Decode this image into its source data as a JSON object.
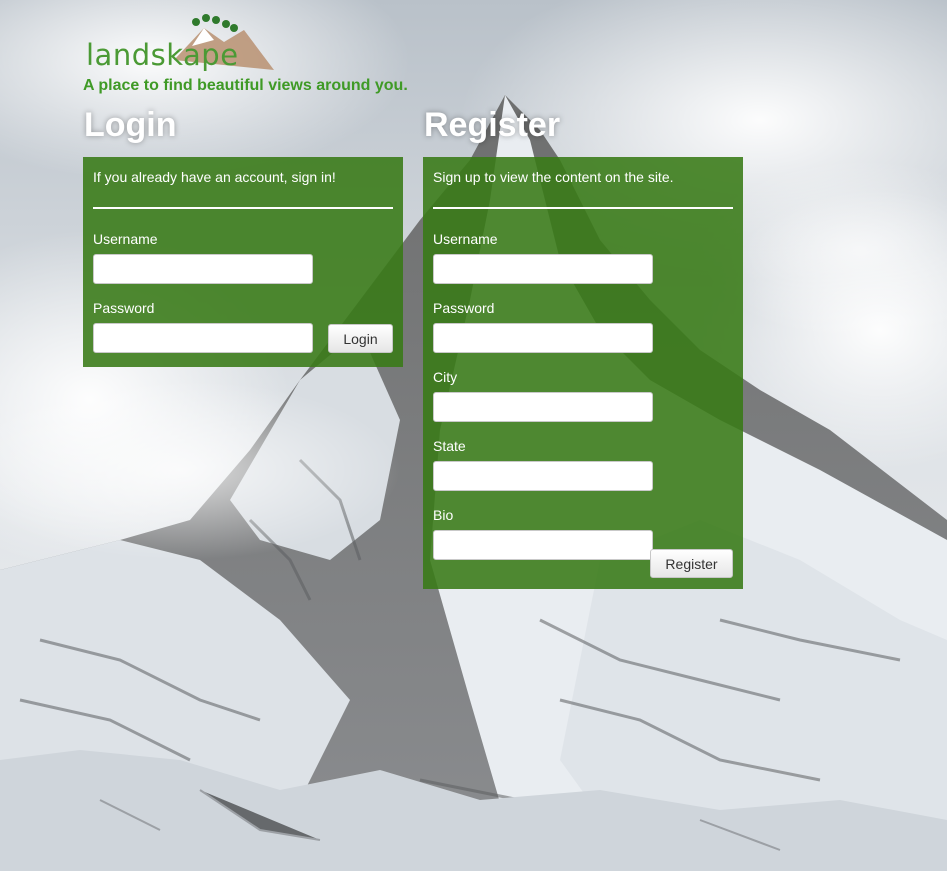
{
  "branding": {
    "logo_text": "landskape",
    "tagline": "A place to find beautiful views around you.",
    "brand_color": "#3f9a26"
  },
  "login": {
    "title": "Login",
    "intro": "If you already have an account, sign in!",
    "username_label": "Username",
    "username_value": "",
    "password_label": "Password",
    "password_value": "",
    "submit_label": "Login"
  },
  "register": {
    "title": "Register",
    "intro": "Sign up to view the content on the site.",
    "username_label": "Username",
    "username_value": "",
    "password_label": "Password",
    "password_value": "",
    "city_label": "City",
    "city_value": "",
    "state_label": "State",
    "state_value": "",
    "bio_label": "Bio",
    "bio_value": "",
    "submit_label": "Register"
  },
  "colors": {
    "panel_green": "#387a16",
    "title_white": "#ffffff"
  },
  "background": {
    "icon": "mountain-landscape-icon"
  }
}
